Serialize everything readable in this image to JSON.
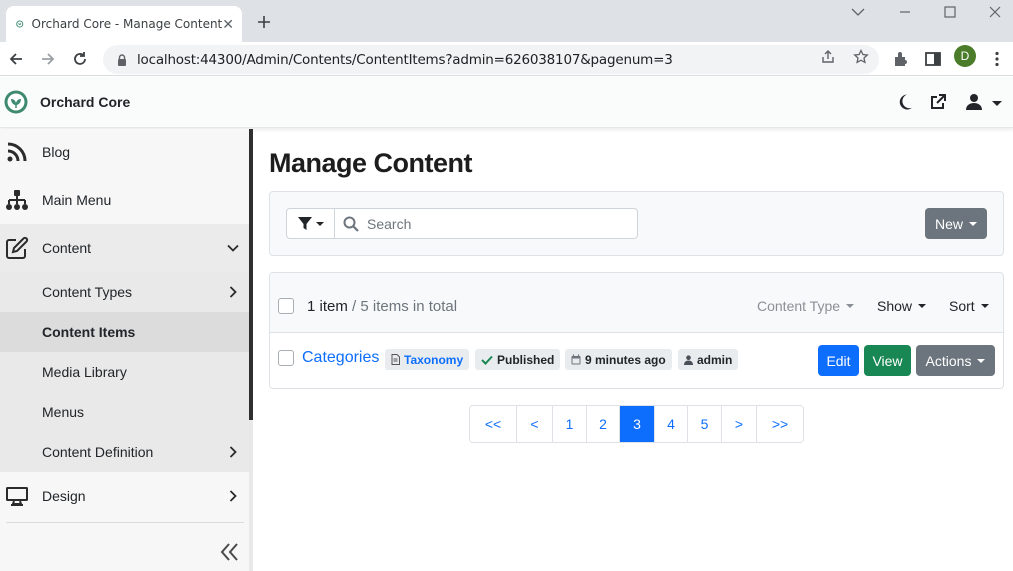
{
  "browser": {
    "tab_title": "Orchard Core - Manage Content",
    "url": "localhost:44300/Admin/Contents/ContentItems?admin=626038107&pagenum=3",
    "profile_initial": "D"
  },
  "app": {
    "brand": "Orchard Core"
  },
  "sidebar": {
    "items": [
      {
        "label": "Blog",
        "icon": "rss-icon"
      },
      {
        "label": "Main Menu",
        "icon": "sitemap-icon"
      },
      {
        "label": "Content",
        "icon": "edit-icon"
      },
      {
        "label": "Content Types"
      },
      {
        "label": "Content Items"
      },
      {
        "label": "Media Library"
      },
      {
        "label": "Menus"
      },
      {
        "label": "Content Definition"
      },
      {
        "label": "Design",
        "icon": "desktop-icon"
      }
    ]
  },
  "main": {
    "title": "Manage Content",
    "search_placeholder": "Search",
    "new_button": "New",
    "list": {
      "count": "1 item",
      "total": "/ 5 items in total",
      "filters": {
        "content_type": "Content Type",
        "show": "Show",
        "sort": "Sort"
      },
      "rows": [
        {
          "title": "Categories",
          "type_badge": "Taxonomy",
          "status_badge": "Published",
          "time_badge": "9 minutes ago",
          "author_badge": "admin",
          "edit": "Edit",
          "view": "View",
          "actions": "Actions"
        }
      ]
    },
    "pager": {
      "first": "<<",
      "prev": "<",
      "pages": [
        "1",
        "2",
        "3",
        "4",
        "5"
      ],
      "active": "3",
      "next": ">",
      "last": ">>"
    }
  },
  "colors": {
    "primary": "#0d6efd",
    "success": "#198754",
    "secondary": "#6c757d"
  }
}
